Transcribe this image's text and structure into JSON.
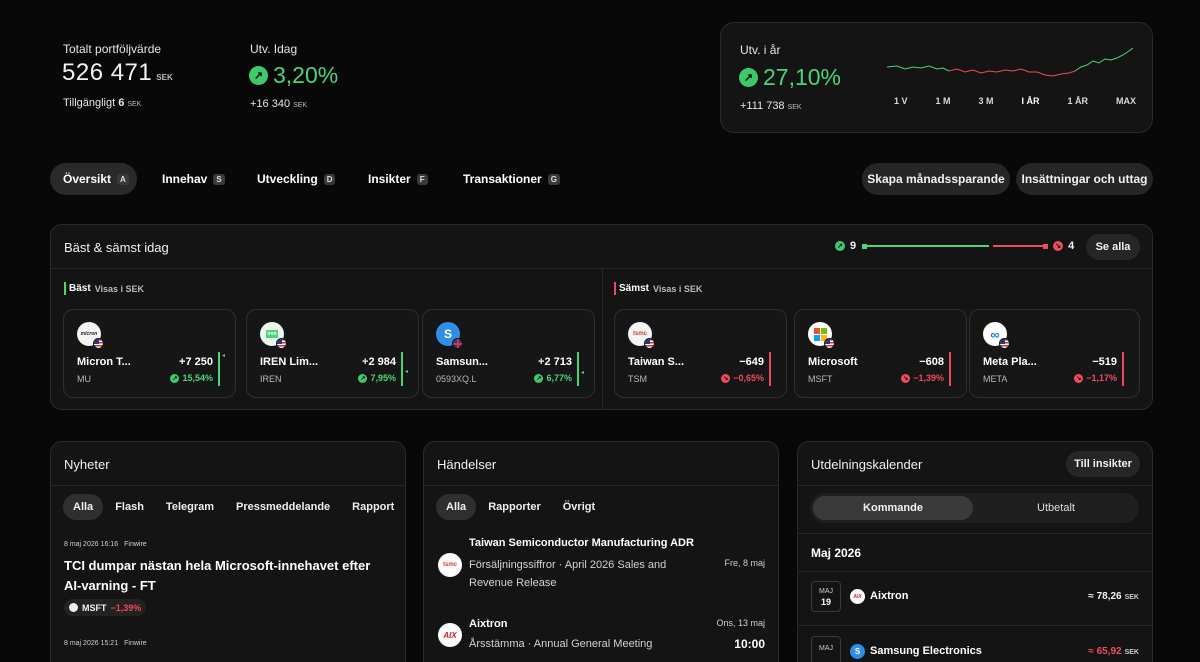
{
  "summary": {
    "total_label": "Totalt portföljvärde",
    "total_value": "526 471",
    "total_currency": "SEK",
    "available_label": "Tillgängligt",
    "available_value": "6",
    "available_currency": "SEK",
    "today_label": "Utv. Idag",
    "today_pct": "3,20%",
    "today_amount": "+16 340",
    "today_currency": "SEK"
  },
  "ytd": {
    "label": "Utv. i år",
    "pct": "27,10%",
    "amount": "+111 738",
    "currency": "SEK",
    "ranges": [
      "1 V",
      "1 M",
      "3 M",
      "I ÅR",
      "1 ÅR",
      "MAX"
    ],
    "active_range": "I ÅR",
    "colors": {
      "up": "#4bd47a",
      "down": "#ef4b5f"
    }
  },
  "tabs": [
    {
      "label": "Översikt",
      "key": "A"
    },
    {
      "label": "Innehav",
      "key": "S"
    },
    {
      "label": "Utveckling",
      "key": "D"
    },
    {
      "label": "Insikter",
      "key": "F"
    },
    {
      "label": "Transaktioner",
      "key": "G"
    }
  ],
  "actions": {
    "monthly": "Skapa månadssparande",
    "deposits": "Insättningar och uttag"
  },
  "movers": {
    "title": "Bäst & sämst idag",
    "up_count": "9",
    "down_count": "4",
    "see_all": "Se alla",
    "best_label": "Bäst",
    "worst_label": "Sämst",
    "shown_in": "Visas i SEK",
    "best": [
      {
        "name": "Micron T...",
        "symbol": "MU",
        "value": "+7 250",
        "pct": "15,54%",
        "logo": "micron",
        "flag": "us"
      },
      {
        "name": "IREN Lim...",
        "symbol": "IREN",
        "value": "+2 984",
        "pct": "7,95%",
        "logo": "iren",
        "flag": "us"
      },
      {
        "name": "Samsun...",
        "symbol": "0593XQ.L",
        "value": "+2 713",
        "pct": "6,77%",
        "logo": "S",
        "flag": "uk"
      }
    ],
    "worst": [
      {
        "name": "Taiwan S...",
        "symbol": "TSM",
        "value": "−649",
        "pct": "−0,65%",
        "logo": "tsmc",
        "flag": "us"
      },
      {
        "name": "Microsoft",
        "symbol": "MSFT",
        "value": "−608",
        "pct": "−1,39%",
        "logo": "ms",
        "flag": "us"
      },
      {
        "name": "Meta Pla...",
        "symbol": "META",
        "value": "−519",
        "pct": "−1,17%",
        "logo": "meta",
        "flag": "us"
      }
    ]
  },
  "news": {
    "title": "Nyheter",
    "filters": [
      "Alla",
      "Flash",
      "Telegram",
      "Pressmeddelande",
      "Rapport"
    ],
    "items": [
      {
        "time": "8 maj 2026 16:16",
        "source": "Finwire",
        "headline": "TCI dumpar nästan hela Microsoft-innehavet efter AI-varning - FT",
        "ticker": "MSFT",
        "ticker_pct": "−1,39%"
      },
      {
        "time": "8 maj 2026 15:21",
        "source": "Finwire"
      }
    ]
  },
  "events": {
    "title": "Händelser",
    "filters": [
      "Alla",
      "Rapporter",
      "Övrigt"
    ],
    "items": [
      {
        "company": "Taiwan Semiconductor Manufacturing ADR",
        "desc": "Försäljningssiffror · April 2026 Sales and Revenue Release",
        "date": "Fre, 8 maj",
        "logo": "tsmc"
      },
      {
        "company": "Aixtron",
        "desc": "Årsstämma · Annual General Meeting",
        "date": "Ons, 13 maj",
        "time": "10:00",
        "logo": "AIX"
      }
    ]
  },
  "dividends": {
    "title": "Utdelningskalender",
    "insights_button": "Till insikter",
    "toggle": [
      "Kommande",
      "Utbetalt"
    ],
    "month": "Maj 2026",
    "items": [
      {
        "month": "MAJ",
        "day": "19",
        "company": "Aixtron",
        "amount": "≈ 78,26",
        "currency": "SEK",
        "logo": "AIX"
      },
      {
        "month": "MAJ",
        "day": "",
        "company": "Samsung Electronics",
        "amount": "≈ 65,92",
        "currency": "SEK",
        "logo": "S"
      }
    ]
  }
}
